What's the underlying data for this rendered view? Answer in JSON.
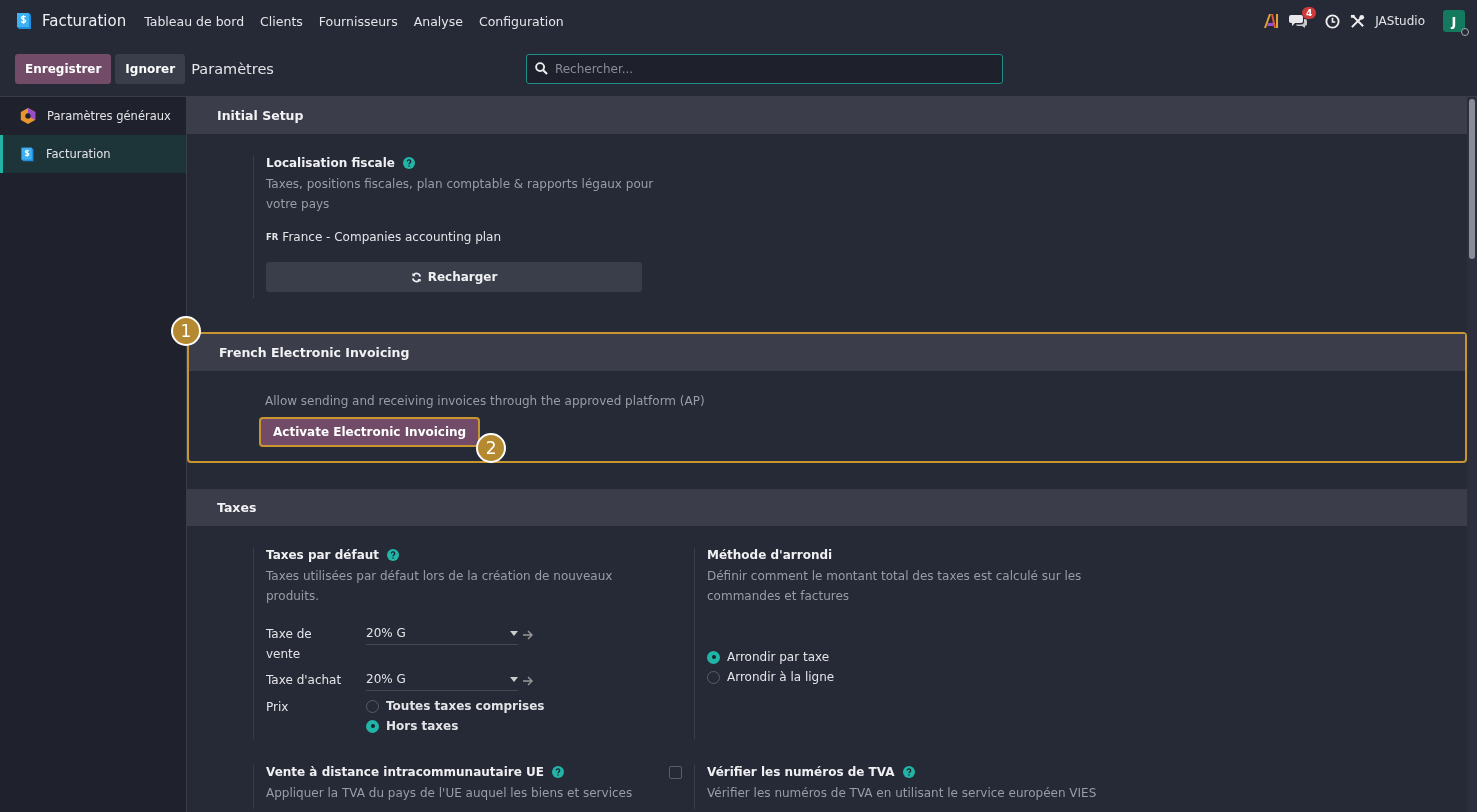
{
  "app": {
    "name": "Facturation"
  },
  "menu": [
    {
      "label": "Tableau de bord"
    },
    {
      "label": "Clients"
    },
    {
      "label": "Fournisseurs"
    },
    {
      "label": "Analyse"
    },
    {
      "label": "Configuration"
    }
  ],
  "systray": {
    "messages_count": "4",
    "company": "JAStudio",
    "avatar": "J"
  },
  "control_panel": {
    "save": "Enregistrer",
    "discard": "Ignorer",
    "breadcrumb": "Paramètres",
    "search": {
      "placeholder": "Rechercher..."
    }
  },
  "sidebar": {
    "items": [
      {
        "label": "Paramètres généraux",
        "kind": "general",
        "selected": false
      },
      {
        "label": "Facturation",
        "kind": "invoicing",
        "selected": true
      }
    ]
  },
  "sections": [
    {
      "title": "Initial Setup",
      "kind": "settings",
      "settings": [
        {
          "title": "Localisation fiscale",
          "help": true,
          "description": "Taxes, positions fiscales, plan comptable & rapports légaux pour votre pays",
          "value_code": "FR",
          "value": "France - Companies accounting plan",
          "button": "Recharger"
        }
      ]
    },
    {
      "title": "French Electronic Invoicing",
      "kind": "action",
      "annotation": "1",
      "description": "Allow sending and receiving invoices through the approved platform (AP)",
      "button": "Activate Electronic Invoicing",
      "button_annotation": "2"
    },
    {
      "title": "Taxes",
      "kind": "settings",
      "settings": [
        {
          "title": "Taxes par défaut",
          "help": true,
          "description": "Taxes utilisées par défaut lors de la création de nouveaux produits.",
          "fields": [
            {
              "kind": "select",
              "label": "Taxe de vente",
              "value": "20% G"
            },
            {
              "kind": "select",
              "label": "Taxe d'achat",
              "value": "20% G"
            },
            {
              "kind": "radio",
              "label": "Prix",
              "options": [
                {
                  "label": "Toutes taxes comprises",
                  "selected": false
                },
                {
                  "label": "Hors taxes",
                  "selected": true
                }
              ]
            }
          ]
        },
        {
          "title": "Méthode d'arrondi",
          "help": false,
          "description": "Définir comment le montant total des taxes est calculé sur les commandes et factures",
          "options": [
            {
              "label": "Arrondir par taxe",
              "selected": true
            },
            {
              "label": "Arrondir à la ligne",
              "selected": false
            }
          ]
        },
        {
          "title": "Vente à distance intracommunautaire UE",
          "help": true,
          "checked": false,
          "description": "Appliquer la TVA du pays de l'UE auquel les biens et services"
        },
        {
          "title": "Vérifier les numéros de TVA",
          "help": true,
          "description": "Vérifier les numéros de TVA en utilisant le service européen VIES"
        }
      ]
    }
  ]
}
